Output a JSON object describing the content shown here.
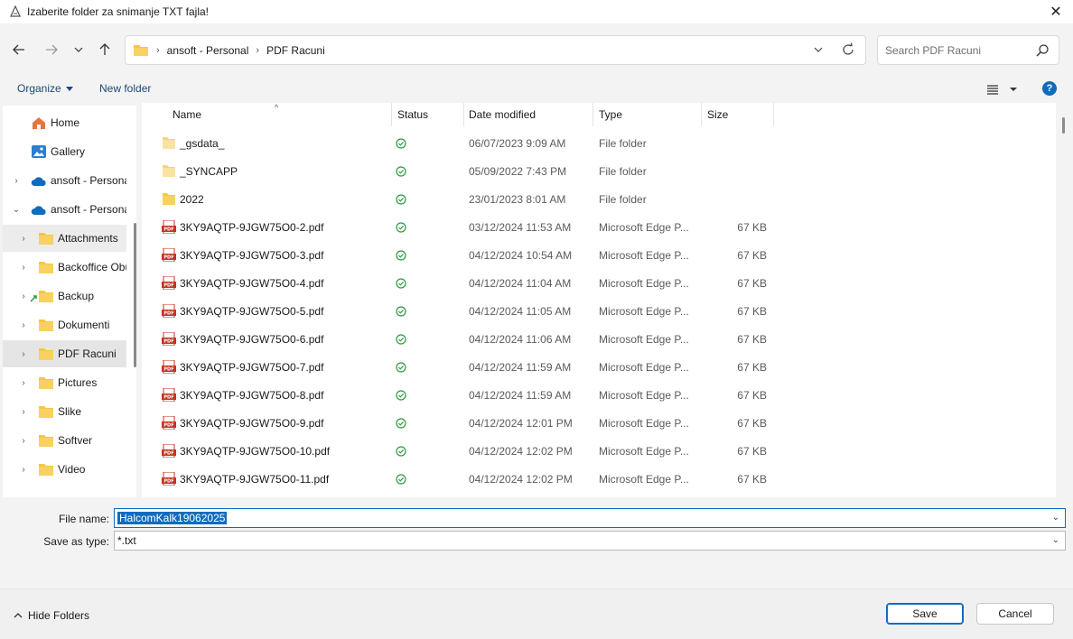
{
  "window": {
    "title": "Izaberite folder za snimanje TXT fajla!"
  },
  "address": {
    "crumbs": [
      "ansoft - Personal",
      "PDF Racuni"
    ]
  },
  "search": {
    "placeholder": "Search PDF Racuni"
  },
  "toolbar": {
    "organize_label": "Organize",
    "new_folder_label": "New folder"
  },
  "sidebar": {
    "items": [
      {
        "label": "Home",
        "icon": "home-icon"
      },
      {
        "label": "Gallery",
        "icon": "gallery-icon"
      },
      {
        "label": "ansoft - Personal",
        "icon": "onedrive-cloud-icon"
      },
      {
        "label": "ansoft - Personal",
        "icon": "onedrive-cloud-icon"
      },
      {
        "label": "Attachments",
        "icon": "folder-icon"
      },
      {
        "label": "Backoffice Obuka",
        "icon": "folder-icon"
      },
      {
        "label": "Backup",
        "icon": "folder-icon"
      },
      {
        "label": "Dokumenti",
        "icon": "folder-icon"
      },
      {
        "label": "PDF Racuni",
        "icon": "folder-icon"
      },
      {
        "label": "Pictures",
        "icon": "folder-icon"
      },
      {
        "label": "Slike",
        "icon": "folder-icon"
      },
      {
        "label": "Softver",
        "icon": "folder-icon"
      },
      {
        "label": "Video",
        "icon": "folder-icon"
      }
    ]
  },
  "columns": {
    "name": "Name",
    "status": "Status",
    "date": "Date modified",
    "type": "Type",
    "size": "Size"
  },
  "files": [
    {
      "name": "_gsdata_",
      "date": "06/07/2023 9:09 AM",
      "type": "File folder",
      "size": "",
      "icon": "folder-light"
    },
    {
      "name": "_SYNCAPP",
      "date": "05/09/2022 7:43 PM",
      "type": "File folder",
      "size": "",
      "icon": "folder-light"
    },
    {
      "name": "2022",
      "date": "23/01/2023 8:01 AM",
      "type": "File folder",
      "size": "",
      "icon": "folder"
    },
    {
      "name": "3KY9AQTP-9JGW75O0-2.pdf",
      "date": "03/12/2024 11:53 AM",
      "type": "Microsoft Edge P...",
      "size": "67 KB",
      "icon": "pdf"
    },
    {
      "name": "3KY9AQTP-9JGW75O0-3.pdf",
      "date": "04/12/2024 10:54 AM",
      "type": "Microsoft Edge P...",
      "size": "67 KB",
      "icon": "pdf"
    },
    {
      "name": "3KY9AQTP-9JGW75O0-4.pdf",
      "date": "04/12/2024 11:04 AM",
      "type": "Microsoft Edge P...",
      "size": "67 KB",
      "icon": "pdf"
    },
    {
      "name": "3KY9AQTP-9JGW75O0-5.pdf",
      "date": "04/12/2024 11:05 AM",
      "type": "Microsoft Edge P...",
      "size": "67 KB",
      "icon": "pdf"
    },
    {
      "name": "3KY9AQTP-9JGW75O0-6.pdf",
      "date": "04/12/2024 11:06 AM",
      "type": "Microsoft Edge P...",
      "size": "67 KB",
      "icon": "pdf"
    },
    {
      "name": "3KY9AQTP-9JGW75O0-7.pdf",
      "date": "04/12/2024 11:59 AM",
      "type": "Microsoft Edge P...",
      "size": "67 KB",
      "icon": "pdf"
    },
    {
      "name": "3KY9AQTP-9JGW75O0-8.pdf",
      "date": "04/12/2024 11:59 AM",
      "type": "Microsoft Edge P...",
      "size": "67 KB",
      "icon": "pdf"
    },
    {
      "name": "3KY9AQTP-9JGW75O0-9.pdf",
      "date": "04/12/2024 12:01 PM",
      "type": "Microsoft Edge P...",
      "size": "67 KB",
      "icon": "pdf"
    },
    {
      "name": "3KY9AQTP-9JGW75O0-10.pdf",
      "date": "04/12/2024 12:02 PM",
      "type": "Microsoft Edge P...",
      "size": "67 KB",
      "icon": "pdf"
    },
    {
      "name": "3KY9AQTP-9JGW75O0-11.pdf",
      "date": "04/12/2024 12:02 PM",
      "type": "Microsoft Edge P...",
      "size": "67 KB",
      "icon": "pdf"
    }
  ],
  "form": {
    "file_name_label": "File name:",
    "file_name_value": "HalcomKalk19062025",
    "save_type_label": "Save as type:",
    "save_type_value": "*.txt"
  },
  "footer": {
    "hide_folders_label": "Hide Folders",
    "save_label": "Save",
    "cancel_label": "Cancel"
  },
  "colors": {
    "accent": "#0f6cbd",
    "folder": "#f6c643",
    "pdf": "#c7321f",
    "status_ok": "#2e9a3e"
  }
}
